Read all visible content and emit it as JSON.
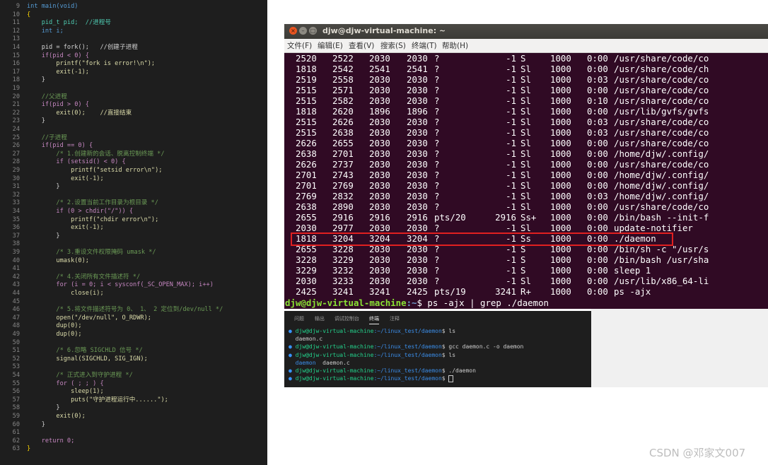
{
  "editor": {
    "lines": [
      {
        "n": "9",
        "t": "int main(void)",
        "c": "#569cd6"
      },
      {
        "n": "10",
        "t": "{",
        "c": "#ffd700"
      },
      {
        "n": "11",
        "t": "    pid_t pid;  //进程号",
        "c": "#4ec9b0"
      },
      {
        "n": "12",
        "t": "    int i;",
        "c": "#569cd6"
      },
      {
        "n": "13",
        "t": "",
        "c": "#d4d4d4"
      },
      {
        "n": "14",
        "t": "    pid = fork();   //创建子进程",
        "c": "#d4d4d4"
      },
      {
        "n": "15",
        "t": "    if(pid < 0) {",
        "c": "#c586c0"
      },
      {
        "n": "16",
        "t": "        printf(\"fork is error!\\n\");",
        "c": "#dcdcaa"
      },
      {
        "n": "17",
        "t": "        exit(-1);",
        "c": "#dcdcaa"
      },
      {
        "n": "18",
        "t": "    }",
        "c": "#d4d4d4"
      },
      {
        "n": "19",
        "t": "",
        "c": "#d4d4d4"
      },
      {
        "n": "20",
        "t": "    //父进程",
        "c": "#6a9955"
      },
      {
        "n": "21",
        "t": "    if(pid > 0) {",
        "c": "#c586c0"
      },
      {
        "n": "22",
        "t": "        exit(0);    //直接结束",
        "c": "#dcdcaa"
      },
      {
        "n": "23",
        "t": "    }",
        "c": "#d4d4d4"
      },
      {
        "n": "24",
        "t": "",
        "c": "#d4d4d4"
      },
      {
        "n": "25",
        "t": "    //子进程",
        "c": "#6a9955"
      },
      {
        "n": "26",
        "t": "    if(pid == 0) {",
        "c": "#c586c0"
      },
      {
        "n": "27",
        "t": "        /* 1.创建新的会话、脱离控制终端 */",
        "c": "#6a9955"
      },
      {
        "n": "28",
        "t": "        if (setsid() < 0) {",
        "c": "#c586c0"
      },
      {
        "n": "29",
        "t": "            printf(\"setsid error\\n\");",
        "c": "#dcdcaa"
      },
      {
        "n": "30",
        "t": "            exit(-1);",
        "c": "#dcdcaa"
      },
      {
        "n": "31",
        "t": "        }",
        "c": "#d4d4d4"
      },
      {
        "n": "32",
        "t": "",
        "c": "#d4d4d4"
      },
      {
        "n": "33",
        "t": "        /* 2.设置当前工作目录为根目录 */",
        "c": "#6a9955"
      },
      {
        "n": "34",
        "t": "        if (0 > chdir(\"/\")) {",
        "c": "#c586c0"
      },
      {
        "n": "35",
        "t": "            printf(\"chdir error\\n\");",
        "c": "#dcdcaa"
      },
      {
        "n": "36",
        "t": "            exit(-1);",
        "c": "#dcdcaa"
      },
      {
        "n": "37",
        "t": "        }",
        "c": "#d4d4d4"
      },
      {
        "n": "38",
        "t": "",
        "c": "#d4d4d4"
      },
      {
        "n": "39",
        "t": "        /* 3.重设文件权限掩码 umask */",
        "c": "#6a9955"
      },
      {
        "n": "40",
        "t": "        umask(0);",
        "c": "#dcdcaa"
      },
      {
        "n": "41",
        "t": "",
        "c": "#d4d4d4"
      },
      {
        "n": "42",
        "t": "        /* 4.关闭所有文件描述符 */",
        "c": "#6a9955"
      },
      {
        "n": "43",
        "t": "        for (i = 0; i < sysconf(_SC_OPEN_MAX); i++)",
        "c": "#c586c0"
      },
      {
        "n": "44",
        "t": "            close(i);",
        "c": "#dcdcaa"
      },
      {
        "n": "45",
        "t": "",
        "c": "#d4d4d4"
      },
      {
        "n": "46",
        "t": "        /* 5.将文件描述符号为 0、 1、 2 定位到/dev/null */",
        "c": "#6a9955"
      },
      {
        "n": "47",
        "t": "        open(\"/dev/null\", O_RDWR);",
        "c": "#dcdcaa"
      },
      {
        "n": "48",
        "t": "        dup(0);",
        "c": "#dcdcaa"
      },
      {
        "n": "49",
        "t": "        dup(0);",
        "c": "#dcdcaa"
      },
      {
        "n": "50",
        "t": "",
        "c": "#d4d4d4"
      },
      {
        "n": "51",
        "t": "        /* 6.忽略 SIGCHLD 信号 */",
        "c": "#6a9955"
      },
      {
        "n": "52",
        "t": "        signal(SIGCHLD, SIG_IGN);",
        "c": "#dcdcaa"
      },
      {
        "n": "53",
        "t": "",
        "c": "#d4d4d4"
      },
      {
        "n": "54",
        "t": "        /* 正式进入到守护进程 */",
        "c": "#6a9955"
      },
      {
        "n": "55",
        "t": "        for ( ; ; ) {",
        "c": "#c586c0"
      },
      {
        "n": "56",
        "t": "            sleep(1);",
        "c": "#dcdcaa"
      },
      {
        "n": "57",
        "t": "            puts(\"守护进程运行中......\");",
        "c": "#dcdcaa"
      },
      {
        "n": "58",
        "t": "        }",
        "c": "#d4d4d4"
      },
      {
        "n": "59",
        "t": "        exit(0);",
        "c": "#dcdcaa"
      },
      {
        "n": "60",
        "t": "    }",
        "c": "#d4d4d4"
      },
      {
        "n": "61",
        "t": "",
        "c": "#d4d4d4"
      },
      {
        "n": "62",
        "t": "    return 0;",
        "c": "#c586c0"
      },
      {
        "n": "63",
        "t": "}",
        "c": "#ffd700"
      }
    ]
  },
  "terminal": {
    "title": "djw@djw-virtual-machine: ~",
    "buttons": {
      "close": "×",
      "min": "–",
      "max": "□"
    },
    "menu": [
      "文件(F)",
      "编辑(E)",
      "查看(V)",
      "搜索(S)",
      "终端(T)",
      "帮助(H)"
    ],
    "rows": [
      [
        "2520",
        "2522",
        "2030",
        "2030",
        "?",
        "-1",
        "S",
        "1000",
        "0:00",
        "/usr/share/code/co"
      ],
      [
        "1818",
        "2542",
        "2541",
        "2541",
        "?",
        "-1",
        "Sl",
        "1000",
        "0:00",
        "/usr/share/code/ch"
      ],
      [
        "2519",
        "2558",
        "2030",
        "2030",
        "?",
        "-1",
        "Sl",
        "1000",
        "0:03",
        "/usr/share/code/co"
      ],
      [
        "2515",
        "2571",
        "2030",
        "2030",
        "?",
        "-1",
        "Sl",
        "1000",
        "0:00",
        "/usr/share/code/co"
      ],
      [
        "2515",
        "2582",
        "2030",
        "2030",
        "?",
        "-1",
        "Sl",
        "1000",
        "0:10",
        "/usr/share/code/co"
      ],
      [
        "1818",
        "2620",
        "1896",
        "1896",
        "?",
        "-1",
        "Sl",
        "1000",
        "0:00",
        "/usr/lib/gvfs/gvfs"
      ],
      [
        "2515",
        "2626",
        "2030",
        "2030",
        "?",
        "-1",
        "Sl",
        "1000",
        "0:03",
        "/usr/share/code/co"
      ],
      [
        "2515",
        "2638",
        "2030",
        "2030",
        "?",
        "-1",
        "Sl",
        "1000",
        "0:03",
        "/usr/share/code/co"
      ],
      [
        "2626",
        "2655",
        "2030",
        "2030",
        "?",
        "-1",
        "Sl",
        "1000",
        "0:00",
        "/usr/share/code/co"
      ],
      [
        "2638",
        "2701",
        "2030",
        "2030",
        "?",
        "-1",
        "Sl",
        "1000",
        "0:00",
        "/home/djw/.config/"
      ],
      [
        "2626",
        "2737",
        "2030",
        "2030",
        "?",
        "-1",
        "Sl",
        "1000",
        "0:00",
        "/usr/share/code/co"
      ],
      [
        "2701",
        "2743",
        "2030",
        "2030",
        "?",
        "-1",
        "Sl",
        "1000",
        "0:00",
        "/home/djw/.config/"
      ],
      [
        "2701",
        "2769",
        "2030",
        "2030",
        "?",
        "-1",
        "Sl",
        "1000",
        "0:00",
        "/home/djw/.config/"
      ],
      [
        "2769",
        "2832",
        "2030",
        "2030",
        "?",
        "-1",
        "Sl",
        "1000",
        "0:03",
        "/home/djw/.config/"
      ],
      [
        "2638",
        "2890",
        "2030",
        "2030",
        "?",
        "-1",
        "Sl",
        "1000",
        "0:00",
        "/usr/share/code/co"
      ],
      [
        "2655",
        "2916",
        "2916",
        "2916",
        "pts/20",
        "2916",
        "Ss+",
        "1000",
        "0:00",
        "/bin/bash --init-f"
      ],
      [
        "2030",
        "2977",
        "2030",
        "2030",
        "?",
        "-1",
        "Sl",
        "1000",
        "0:00",
        "update-notifier"
      ],
      [
        "1818",
        "3204",
        "3204",
        "3204",
        "?",
        "-1",
        "Ss",
        "1000",
        "0:00",
        "./daemon"
      ],
      [
        "2655",
        "3228",
        "2030",
        "2030",
        "?",
        "-1",
        "S",
        "1000",
        "0:00",
        "/bin/sh -c \"/usr/s"
      ],
      [
        "3228",
        "3229",
        "2030",
        "2030",
        "?",
        "-1",
        "S",
        "1000",
        "0:00",
        "/bin/bash /usr/sha"
      ],
      [
        "3229",
        "3232",
        "2030",
        "2030",
        "?",
        "-1",
        "S",
        "1000",
        "0:00",
        "sleep 1"
      ],
      [
        "2030",
        "3233",
        "2030",
        "2030",
        "?",
        "-1",
        "Sl",
        "1000",
        "0:00",
        "/usr/lib/x86_64-li"
      ],
      [
        "2425",
        "3241",
        "3241",
        "2425",
        "pts/19",
        "3241",
        "R+",
        "1000",
        "0:00",
        "ps -ajx"
      ]
    ],
    "prompt": {
      "user": "djw@djw-virtual-machine",
      "path": ":~",
      "cmd": "$ ps -ajx | grep ./daemon"
    }
  },
  "panel": {
    "tabs": [
      "问题",
      "输出",
      "调试控制台",
      "终端",
      "注释"
    ],
    "active_tab": "终端",
    "lines": [
      {
        "bullet": "●",
        "user": "djw@djw-virtual-machine",
        "path": ":~/linux_test/daemon",
        "cmd": "$ ls"
      },
      {
        "out": "daemon.c"
      },
      {
        "bullet": "●",
        "user": "djw@djw-virtual-machine",
        "path": ":~/linux_test/daemon",
        "cmd": "$ gcc daemon.c -o daemon"
      },
      {
        "bullet": "●",
        "user": "djw@djw-virtual-machine",
        "path": ":~/linux_test/daemon",
        "cmd": "$ ls"
      },
      {
        "out_blue": "daemon",
        "out": "  daemon.c"
      },
      {
        "bullet": "●",
        "user": "djw@djw-virtual-machine",
        "path": ":~/linux_test/daemon",
        "cmd": "$ ./daemon"
      },
      {
        "bullet": "●",
        "user": "djw@djw-virtual-machine",
        "path": ":~/linux_test/daemon",
        "cmd": "$ "
      }
    ]
  },
  "watermark": "CSDN @邓家文007",
  "colors": {
    "terminal_bg": "#300a24",
    "highlight": "#e02020",
    "prompt_user": "#8ae234",
    "prompt_path": "#729fcf"
  }
}
